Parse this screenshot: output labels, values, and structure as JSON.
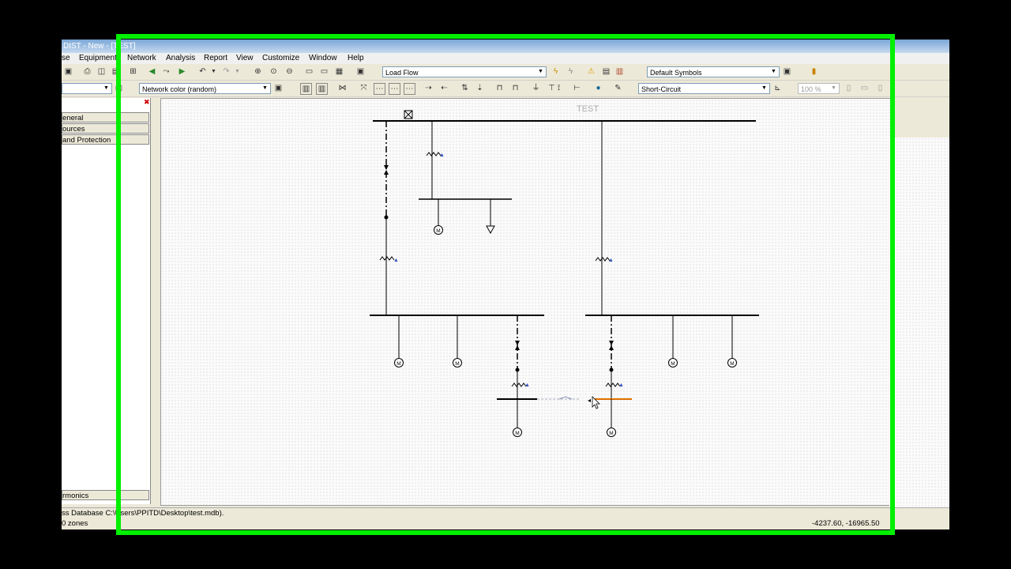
{
  "window": {
    "title": "DIST - New - [TEST]"
  },
  "menu": {
    "items": [
      "se",
      "Equipment",
      "Network",
      "Analysis",
      "Report",
      "View",
      "Customize",
      "Window",
      "Help"
    ]
  },
  "toolbar1": {
    "analysis_mode": "Load Flow",
    "symbols": "Default Symbols"
  },
  "toolbar2": {
    "left_combo": "",
    "network_color": "Network color (random)",
    "study": "Short-Circuit",
    "zoom": "100 %"
  },
  "left_panel": {
    "items": [
      "eneral",
      "ources",
      " and Protection"
    ],
    "bottom_item": "rmonics"
  },
  "diagram": {
    "title": "TEST",
    "motor_label": "M"
  },
  "status": {
    "message": "ss Database C:\\Users\\PPITD\\Desktop\\test.mdb).",
    "zones": "0 zones",
    "coordinates": "-4237.60, -16965.50"
  },
  "colors": {
    "frame": "#00f000",
    "highlight_bus": "#e07000",
    "transformer_accent": "#3050c0"
  }
}
